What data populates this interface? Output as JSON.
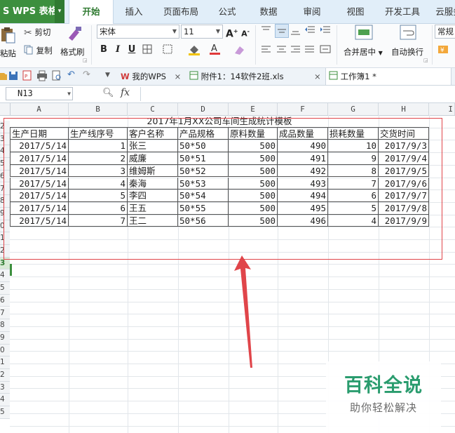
{
  "app": {
    "name": "S WPS 表格",
    "menu_caret": "▾"
  },
  "tabs": [
    "开始",
    "插入",
    "页面布局",
    "公式",
    "数据",
    "审阅",
    "视图",
    "开发工具",
    "云服务"
  ],
  "ribbon": {
    "paste": "粘贴",
    "cut": "剪切",
    "copy": "复制",
    "format_painter": "格式刷",
    "font_name": "宋体",
    "font_size": "11",
    "bold": "B",
    "italic": "I",
    "underline": "U",
    "merge_center": "合并居中",
    "wrap_text": "自动换行",
    "number_format": "常规"
  },
  "doc_tabs": [
    {
      "label": "我的WPS"
    },
    {
      "label": "附件1：14软件2班.xls"
    },
    {
      "label": "工作簿1 *"
    }
  ],
  "formula_bar": {
    "name_box": "N13",
    "fx": "fx"
  },
  "columns": [
    "A",
    "B",
    "C",
    "D",
    "E",
    "F",
    "G",
    "H",
    "I"
  ],
  "row_numbers": [
    "2",
    "3",
    "4",
    "5",
    "6",
    "7",
    "8",
    "9",
    "0",
    "1",
    "2",
    "3",
    "4",
    "5",
    "6",
    "7",
    "8",
    "9",
    "0",
    "1",
    "2",
    "3",
    "4",
    "5"
  ],
  "sheet": {
    "title": "2017年1月XX公司车间生成统计模板",
    "headers": [
      "生产日期",
      "生产线序号",
      "客户名称",
      "产品规格",
      "原料数量",
      "成品数量",
      "损耗数量",
      "交货时间"
    ],
    "rows": [
      [
        "2017/5/14",
        "1",
        "张三",
        "50*50",
        "500",
        "490",
        "10",
        "2017/9/3"
      ],
      [
        "2017/5/14",
        "2",
        "威廉",
        "50*51",
        "500",
        "491",
        "9",
        "2017/9/4"
      ],
      [
        "2017/5/14",
        "3",
        "维姆斯",
        "50*52",
        "500",
        "492",
        "8",
        "2017/9/5"
      ],
      [
        "2017/5/14",
        "4",
        "秦海",
        "50*53",
        "500",
        "493",
        "7",
        "2017/9/6"
      ],
      [
        "2017/5/14",
        "5",
        "李四",
        "50*54",
        "500",
        "494",
        "6",
        "2017/9/7"
      ],
      [
        "2017/5/14",
        "6",
        "王五",
        "50*55",
        "500",
        "495",
        "5",
        "2017/9/8"
      ],
      [
        "2017/5/14",
        "7",
        "王二",
        "50*56",
        "500",
        "496",
        "4",
        "2017/9/9"
      ]
    ]
  },
  "watermark": {
    "title": "百科全说",
    "subtitle": "助你轻松解决"
  },
  "colors": {
    "accent": "#3c8f3e",
    "annotation": "#e0454a",
    "watermark": "#2a9c6e"
  }
}
